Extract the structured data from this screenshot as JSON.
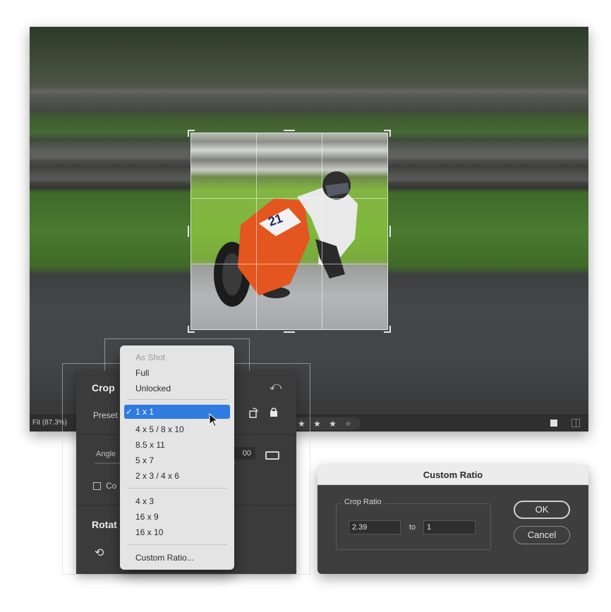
{
  "editor": {
    "zoom_label": "Fit (87.3%)",
    "rating": {
      "filled": "★ ★ ★",
      "empty": "★"
    }
  },
  "crop_panel": {
    "title": "Crop",
    "preset_label": "Preset",
    "angle_label": "Angle",
    "angle_value": "00",
    "constrain_label": "Co",
    "rotate_title": "Rotat"
  },
  "aspect_menu": {
    "items_top": [
      "As Shot",
      "Full",
      "Unlocked"
    ],
    "selected": "1 x 1",
    "check": "✓",
    "items_mid": [
      "4 x 5 / 8 x 10",
      "8.5 x 11",
      "5 x 7",
      "2 x 3 / 4 x 6"
    ],
    "items_wide": [
      "4 x 3",
      "16 x 9",
      "16 x 10"
    ],
    "custom": "Custom Ratio..."
  },
  "custom_ratio": {
    "title": "Custom Ratio",
    "group_label": "Crop Ratio",
    "ratio_a": "2.39",
    "to_label": "to",
    "ratio_b": "1",
    "ok_label": "OK",
    "cancel_label": "Cancel"
  },
  "colors": {
    "menu_highlight": "#2f7be0",
    "panel_bg": "#3b3b3b"
  },
  "icons": [
    "reset-icon",
    "orientation-icon",
    "lock-icon",
    "level-icon",
    "rotate-left-icon",
    "cursor-icon",
    "single-view-icon",
    "compare-view-icon"
  ]
}
